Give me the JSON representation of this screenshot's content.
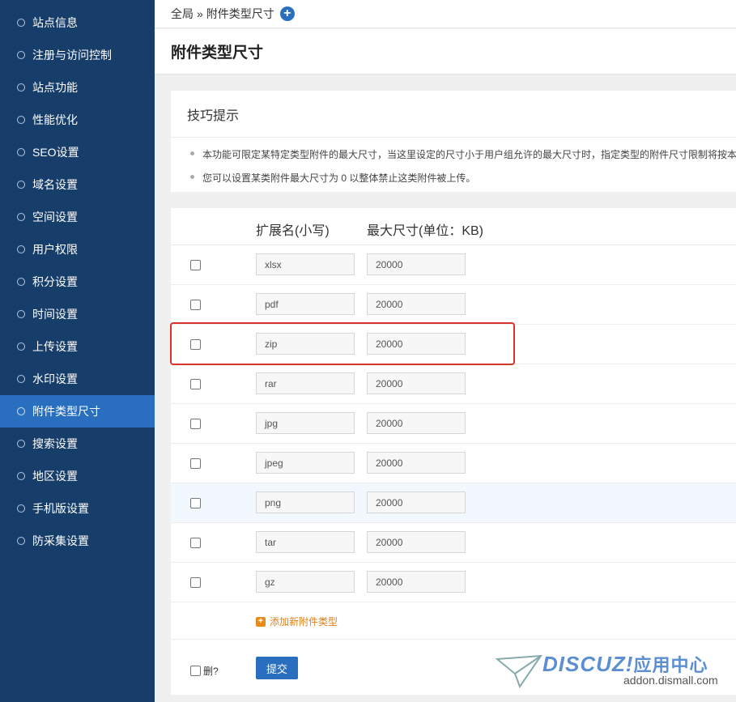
{
  "sidebar": {
    "items": [
      {
        "label": "站点信息",
        "active": false
      },
      {
        "label": "注册与访问控制",
        "active": false
      },
      {
        "label": "站点功能",
        "active": false
      },
      {
        "label": "性能优化",
        "active": false
      },
      {
        "label": "SEO设置",
        "active": false
      },
      {
        "label": "域名设置",
        "active": false
      },
      {
        "label": "空间设置",
        "active": false
      },
      {
        "label": "用户权限",
        "active": false
      },
      {
        "label": "积分设置",
        "active": false
      },
      {
        "label": "时间设置",
        "active": false
      },
      {
        "label": "上传设置",
        "active": false
      },
      {
        "label": "水印设置",
        "active": false
      },
      {
        "label": "附件类型尺寸",
        "active": true
      },
      {
        "label": "搜索设置",
        "active": false
      },
      {
        "label": "地区设置",
        "active": false
      },
      {
        "label": "手机版设置",
        "active": false
      },
      {
        "label": "防采集设置",
        "active": false
      }
    ]
  },
  "breadcrumb": {
    "root": "全局",
    "separator": "»",
    "current": "附件类型尺寸",
    "add_icon": "plus-circle-icon"
  },
  "page_title": "附件类型尺寸",
  "tips": {
    "title": "技巧提示",
    "lines": [
      "本功能可限定某特定类型附件的最大尺寸，当这里设定的尺寸小于用户组允许的最大尺寸时，指定类型的附件尺寸限制将按本",
      "您可以设置某类附件最大尺寸为 0 以整体禁止这类附件被上传。"
    ]
  },
  "table": {
    "headers": {
      "extension": "扩展名(小写)",
      "max_size": "最大尺寸(单位：KB)"
    },
    "rows": [
      {
        "ext": "xlsx",
        "size": "20000"
      },
      {
        "ext": "pdf",
        "size": "20000"
      },
      {
        "ext": "zip",
        "size": "20000"
      },
      {
        "ext": "rar",
        "size": "20000"
      },
      {
        "ext": "jpg",
        "size": "20000"
      },
      {
        "ext": "jpeg",
        "size": "20000"
      },
      {
        "ext": "png",
        "size": "20000"
      },
      {
        "ext": "tar",
        "size": "20000"
      },
      {
        "ext": "gz",
        "size": "20000"
      }
    ],
    "add_link": "添加新附件类型",
    "delete_label": "删?",
    "submit_label": "提交"
  },
  "watermark": {
    "brand": "DISCUZ!",
    "brand_cn": "应用中心",
    "url": "addon.dismall.com"
  },
  "colors": {
    "sidebar_bg": "#173e6b",
    "sidebar_active": "#2a6fbf",
    "accent": "#2a6fbf",
    "highlight_box": "#d9332f",
    "add_link": "#e0801b"
  }
}
